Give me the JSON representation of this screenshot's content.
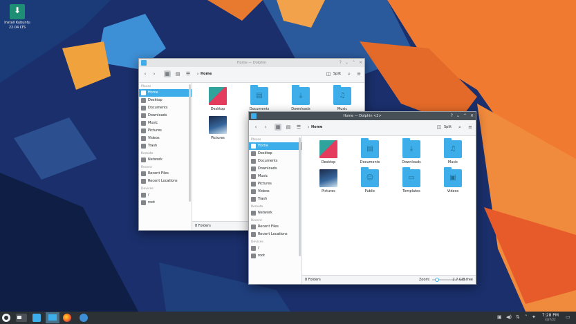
{
  "desktop": {
    "install_icon": "download-icon",
    "install_label_1": "Install Kubuntu",
    "install_label_2": "22.04 LTS"
  },
  "window_back": {
    "title": "Home — Dolphin",
    "breadcrumb": "Home",
    "split_label": "Split",
    "places_sections": {
      "places": "Places",
      "remote": "Remote",
      "recent": "Recent",
      "devices": "Devices"
    },
    "places": [
      "Home",
      "Desktop",
      "Documents",
      "Downloads",
      "Music",
      "Pictures",
      "Videos",
      "Trash"
    ],
    "remote": [
      "Network"
    ],
    "recent": [
      "Recent Files",
      "Recent Locations"
    ],
    "devices": [
      "/",
      "root"
    ],
    "files": [
      "Desktop",
      "Documents",
      "Downloads",
      "Music",
      "Pictures"
    ],
    "status_count": "8 Folders"
  },
  "window_front": {
    "title": "Home — Dolphin <2>",
    "breadcrumb": "Home",
    "split_label": "Split",
    "places_sections": {
      "places": "Places",
      "remote": "Remote",
      "recent": "Recent",
      "devices": "Devices"
    },
    "places": [
      "Home",
      "Desktop",
      "Documents",
      "Downloads",
      "Music",
      "Pictures",
      "Videos",
      "Trash"
    ],
    "remote": [
      "Network"
    ],
    "recent": [
      "Recent Files",
      "Recent Locations"
    ],
    "devices": [
      "/",
      "root"
    ],
    "files": [
      "Desktop",
      "Documents",
      "Downloads",
      "Music",
      "Pictures",
      "Public",
      "Templates",
      "Videos"
    ],
    "status_count": "8 Folders",
    "zoom_label": "Zoom:",
    "zoom_level": 0.1,
    "free_space": "2.7 GiB free"
  },
  "taskbar": {
    "clock_time": "7:28 PM",
    "clock_date": "4/27/22"
  },
  "colors": {
    "accent": "#3daee9",
    "taskbar": "#2c3136",
    "wallpaper_blue": "#1a2f6b",
    "wallpaper_orange": "#f07a30"
  }
}
